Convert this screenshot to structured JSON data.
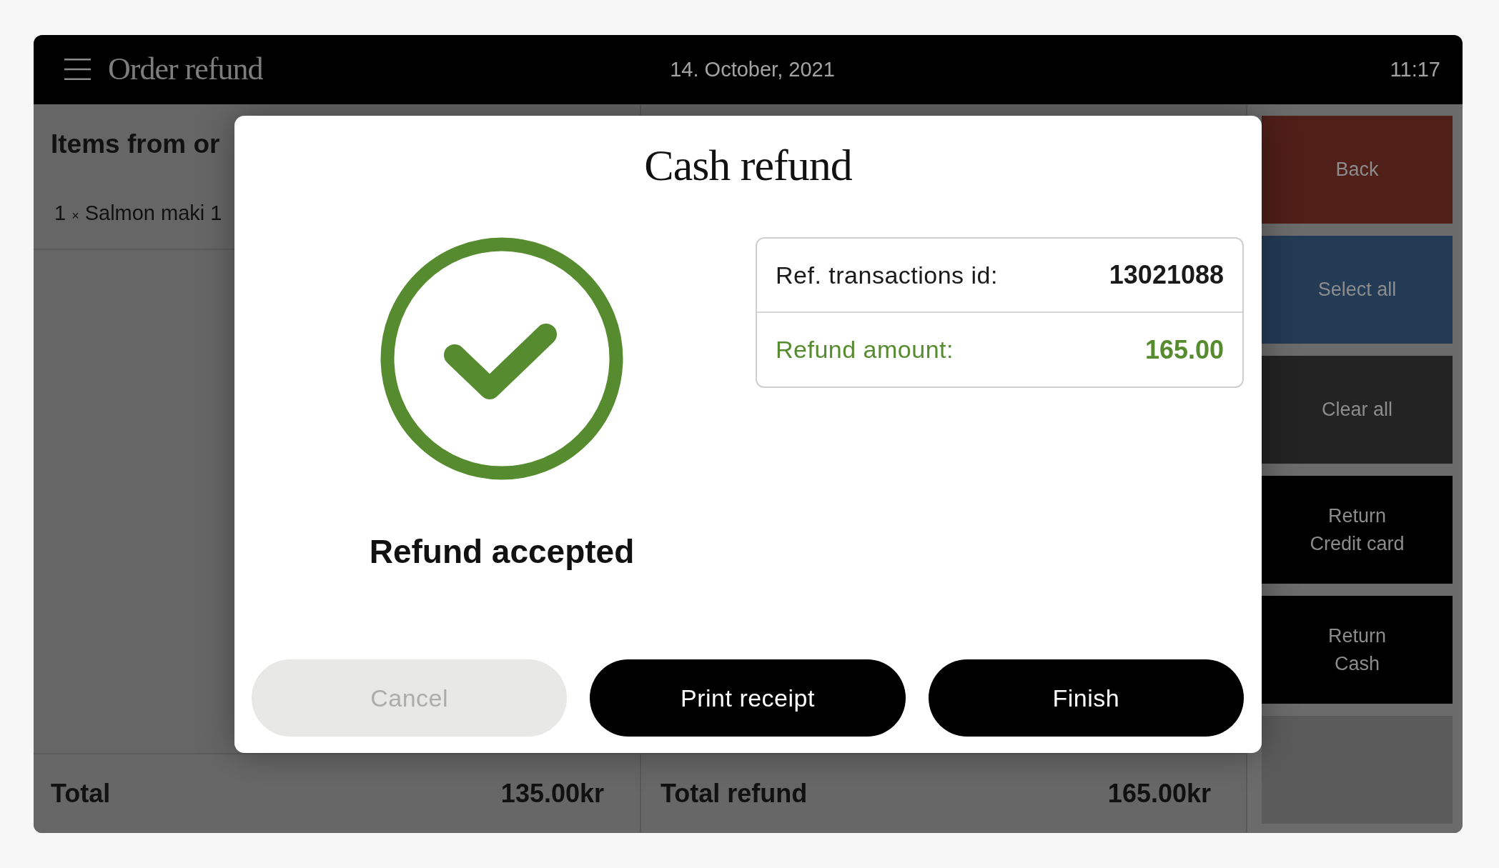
{
  "header": {
    "title": "Order refund",
    "date": "14. October, 2021",
    "time": "11:17"
  },
  "order_items": {
    "title": "Items from or",
    "items": [
      {
        "quantity": "1",
        "times_sign": "×",
        "name": "Salmon maki 1"
      }
    ]
  },
  "totals": [
    {
      "label": "Total",
      "amount": "135.00kr"
    },
    {
      "label": "Total refund",
      "amount": "165.00kr"
    }
  ],
  "sidebar": {
    "buttons": [
      {
        "label": "Back",
        "color": "#4f1f18"
      },
      {
        "label": "Select all",
        "color": "#233b55"
      },
      {
        "label": "Clear all",
        "color": "#232323"
      },
      {
        "label": "Return\nCredit card",
        "color": "#000000"
      },
      {
        "label": "Return\nCash",
        "color": "#000000"
      },
      {
        "color": "#5b5b5b"
      }
    ]
  },
  "dialog": {
    "title": "Cash refund",
    "status": {
      "kind": "success",
      "message": "Refund accepted"
    },
    "details": [
      {
        "kind": "plain",
        "label": "Ref. transactions id:",
        "value": "13021088"
      },
      {
        "kind": "accent",
        "label": "Refund amount:",
        "value": "165.00"
      }
    ],
    "buttons": [
      {
        "label": "Cancel",
        "disabled": true
      },
      {
        "label": "Print receipt",
        "disabled": false
      },
      {
        "label": "Finish",
        "disabled": false
      }
    ]
  }
}
